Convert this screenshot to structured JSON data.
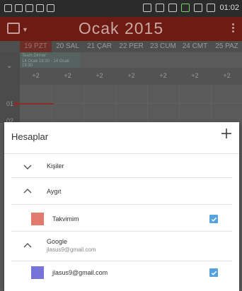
{
  "status_bar": {
    "time": "01:02"
  },
  "calendar": {
    "month_title": "Ocak 2015",
    "days": [
      {
        "label": "19 PZT",
        "today": true
      },
      {
        "label": "20 SAL",
        "today": false
      },
      {
        "label": "21 ÇAR",
        "today": false
      },
      {
        "label": "22 PER",
        "today": false
      },
      {
        "label": "23 CUM",
        "today": false
      },
      {
        "label": "24 CMT",
        "today": false
      },
      {
        "label": "25 PAZ",
        "today": false
      }
    ],
    "event": {
      "title": "Team Dinner",
      "subtitle": "14 Ocak 18:30 - 14 Ocak 19:30"
    },
    "more_counts": [
      "+2",
      "+2",
      "+2",
      "+2",
      "+2",
      "+2",
      "+2"
    ],
    "hour_labels": [
      "01",
      "02"
    ]
  },
  "dialog": {
    "title": "Hesaplar",
    "add_icon": "plus-icon",
    "groups": {
      "kisiler": {
        "label": "Kişiler",
        "expanded": false
      },
      "aygit": {
        "label": "Aygıt",
        "expanded": true
      },
      "google": {
        "label": "Google",
        "sublabel": "jlasus9@gmail.com",
        "expanded": true
      }
    },
    "calendars": {
      "takvimim": {
        "name": "Takvimim",
        "color": "#e07b6e",
        "checked": true
      },
      "gmail": {
        "name": "jlasus9@gmail.com",
        "color": "#7673d9",
        "checked": true
      }
    }
  },
  "colors": {
    "accent": "#55a3dc",
    "header": "#6e1b14"
  }
}
